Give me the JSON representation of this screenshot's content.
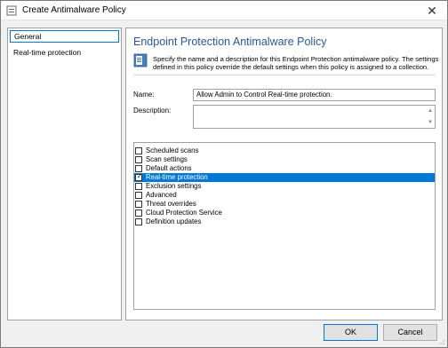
{
  "window": {
    "title": "Create Antimalware Policy"
  },
  "nav": {
    "items": [
      {
        "label": "General",
        "selected": true
      },
      {
        "label": "Real-time protection",
        "selected": false
      }
    ]
  },
  "content": {
    "title": "Endpoint Protection Antimalware Policy",
    "description": "Specify the name and a description for this Endpoint Protection antimalware policy. The settings defined in this policy override the default settings when this policy is assigned to a collection.",
    "name_label": "Name:",
    "name_value": "Allow Admin to Control Real-time protection.",
    "description_label": "Description:",
    "description_value": ""
  },
  "settings": [
    {
      "label": "Scheduled scans",
      "checked": false,
      "selected": false
    },
    {
      "label": "Scan settings",
      "checked": false,
      "selected": false
    },
    {
      "label": "Default actions",
      "checked": false,
      "selected": false
    },
    {
      "label": "Real-time protection",
      "checked": true,
      "selected": true
    },
    {
      "label": "Exclusion settings",
      "checked": false,
      "selected": false
    },
    {
      "label": "Advanced",
      "checked": false,
      "selected": false
    },
    {
      "label": "Threat overrides",
      "checked": false,
      "selected": false
    },
    {
      "label": "Cloud Protection Service",
      "checked": false,
      "selected": false
    },
    {
      "label": "Definition updates",
      "checked": false,
      "selected": false
    }
  ],
  "buttons": {
    "ok": "OK",
    "cancel": "Cancel"
  },
  "colors": {
    "accent": "#0078d7",
    "title": "#2b579a"
  }
}
